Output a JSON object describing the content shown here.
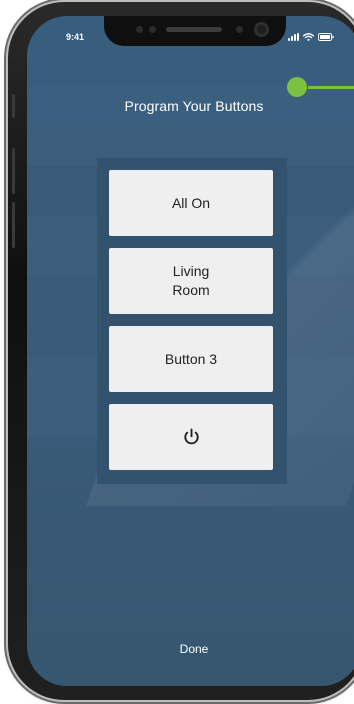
{
  "status_bar": {
    "time": "9:41"
  },
  "screen": {
    "title": "Program Your Buttons",
    "buttons": [
      {
        "label": "All On"
      },
      {
        "label": "Living\nRoom"
      },
      {
        "label": "Button 3"
      },
      {
        "label": "",
        "icon": "power-icon"
      }
    ],
    "done_label": "Done"
  },
  "colors": {
    "screen_background": "#3a5a79",
    "panel_background": "#33526e",
    "button_background": "#efefef",
    "button_text": "#222222",
    "callout_accent": "#7cc242"
  }
}
